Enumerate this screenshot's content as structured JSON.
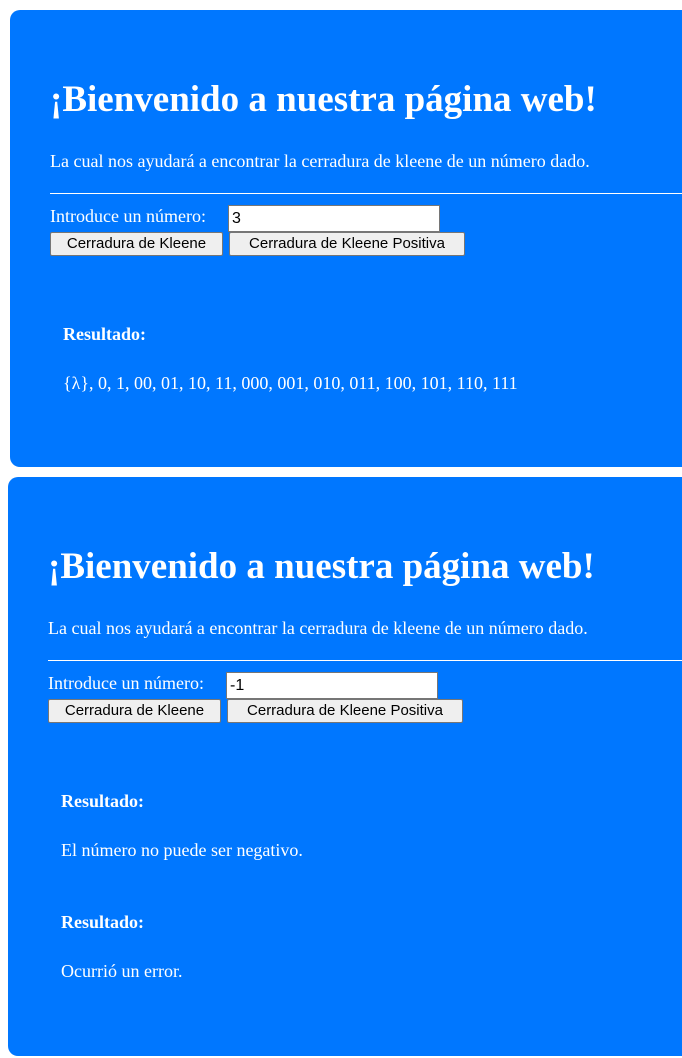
{
  "theme": {
    "panel_color": "#0077ff",
    "text_color": "#ffffff",
    "page_background": "#ffffff"
  },
  "panels": [
    {
      "title": "¡Bienvenido a nuestra página web!",
      "subtitle": "La cual nos ayudará a encontrar la cerradura de kleene de un número dado.",
      "input_label": "Introduce un número:",
      "input_value": "3",
      "kleene_button": "Cerradura de Kleene",
      "kleene_positive_button": "Cerradura de Kleene Positiva",
      "results": [
        {
          "heading": "Resultado:",
          "text": "{λ}, 0, 1, 00, 01, 10, 11, 000, 001, 010, 011, 100, 101, 110, 111"
        }
      ]
    },
    {
      "title": "¡Bienvenido a nuestra página web!",
      "subtitle": "La cual nos ayudará a encontrar la cerradura de kleene de un número dado.",
      "input_label": "Introduce un número:",
      "input_value": "-1",
      "kleene_button": "Cerradura de Kleene",
      "kleene_positive_button": "Cerradura de Kleene Positiva",
      "results": [
        {
          "heading": "Resultado:",
          "text": "El número no puede ser negativo."
        },
        {
          "heading": "Resultado:",
          "text": "Ocurrió un error."
        }
      ]
    }
  ]
}
